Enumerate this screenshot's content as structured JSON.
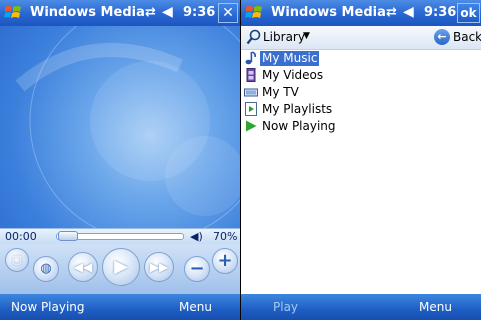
{
  "left": {
    "titlebar": {
      "title": "Windows Media",
      "time": "9:36",
      "close": "✕"
    },
    "player": {
      "elapsed": "00:00",
      "volume": "70%",
      "seek_fraction": 0
    },
    "softkeys": {
      "left": "Now Playing",
      "right": "Menu"
    }
  },
  "right": {
    "titlebar": {
      "title": "Windows Media",
      "time": "9:36",
      "ok": "ok"
    },
    "library": {
      "dropdown": "Library",
      "back": "Back"
    },
    "items": [
      {
        "label": "My Music",
        "icon": "music-note-icon",
        "selected": true
      },
      {
        "label": "My Videos",
        "icon": "film-icon",
        "selected": false
      },
      {
        "label": "My TV",
        "icon": "tv-icon",
        "selected": false
      },
      {
        "label": "My Playlists",
        "icon": "playlist-icon",
        "selected": false
      },
      {
        "label": "Now Playing",
        "icon": "play-arrow-icon",
        "selected": false
      }
    ],
    "softkeys": {
      "left": "Play",
      "right": "Menu"
    }
  },
  "colors": {
    "titlebar": "#2a68d4",
    "selection": "#3a6fd0",
    "softkey_disabled": "#a8c8ee"
  }
}
